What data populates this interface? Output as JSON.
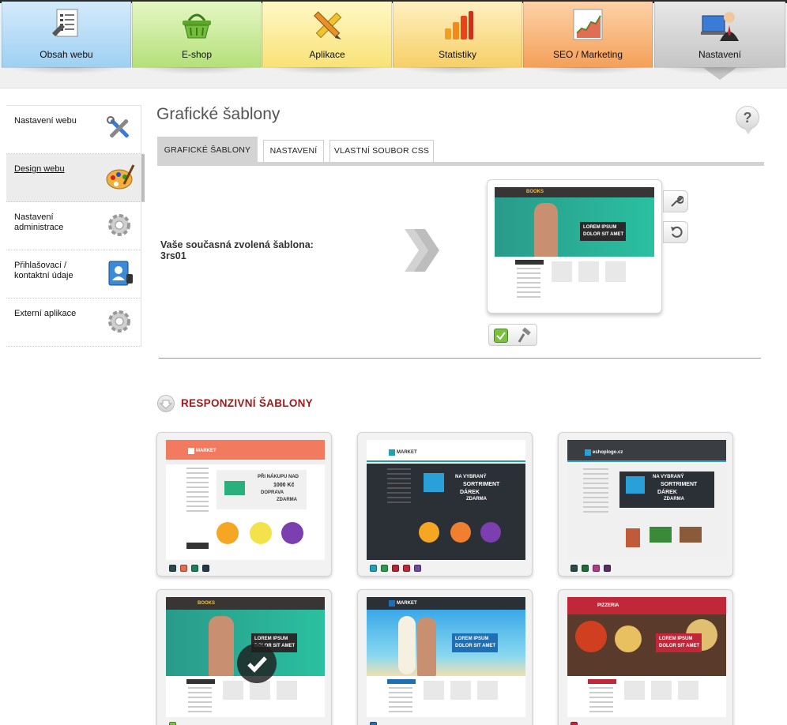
{
  "topnav": {
    "tabs": [
      {
        "label": "Obsah webu",
        "icon": "document-list-icon"
      },
      {
        "label": "E-shop",
        "icon": "shopping-basket-icon"
      },
      {
        "label": "Aplikace",
        "icon": "ruler-pencil-icon"
      },
      {
        "label": "Statistiky",
        "icon": "bar-chart-icon"
      },
      {
        "label": "SEO / Marketing",
        "icon": "growth-chart-icon"
      },
      {
        "label": "Nastavení",
        "icon": "user-computer-icon"
      }
    ],
    "active_index": 5
  },
  "sidebar": {
    "items": [
      {
        "label": "Nastavení webu",
        "icon": "tools-icon"
      },
      {
        "label": "Design webu",
        "icon": "palette-icon",
        "active": true
      },
      {
        "label": "Nastavení administrace",
        "icon": "gear-icon"
      },
      {
        "label": "Přihlašovací / kontaktní údaje",
        "icon": "contact-book-icon"
      },
      {
        "label": "Externí aplikace",
        "icon": "gear-icon"
      }
    ]
  },
  "main": {
    "title": "Grafické šablony",
    "help_label": "?",
    "tabs": [
      {
        "label": "GRAFICKÉ ŠABLONY",
        "active": true
      },
      {
        "label": "NASTAVENÍ"
      },
      {
        "label": "VLASTNÍ SOUBOR CSS"
      }
    ],
    "current": {
      "label": "Vaše současná zvolená šablona:",
      "value": "3rs01"
    },
    "section_title": "RESPONZIVNÍ ŠABLONY"
  },
  "preview_texts": {
    "books_logo": "BOOKS",
    "lorem1": "LOREM IPSUM",
    "lorem2": "DOLOR SIT AMET",
    "market_logo": "MARKET",
    "eshop_logo": "eshoplogo.cz",
    "shipping1": "PŘI NÁKUPU NAD",
    "shipping2": "1000 Kč",
    "shipping3": "DOPRAVA",
    "shipping4": "ZDARMA",
    "assort1": "NA VYBRANÝ",
    "assort2": "SORTRIMENT",
    "assort3": "DÁREK",
    "assort4": "ZDARMA",
    "pizza_logo": "PIZZERIA"
  },
  "templates": [
    {
      "name": "market-orange",
      "swatches": [
        "#2b4a4a",
        "#e76a4f",
        "#1e7f5c",
        "#1f3a4a"
      ]
    },
    {
      "name": "market-dark",
      "swatches": [
        "#1fa3b4",
        "#2e9b4a",
        "#b0282f",
        "#c0283a",
        "#6b4aa0"
      ]
    },
    {
      "name": "eshoplogo",
      "swatches": [
        "#2b4a4a",
        "#1e6b3a",
        "#b03a8a",
        "#5a2a6b"
      ]
    },
    {
      "name": "books",
      "swatches": [
        "#7bc043"
      ],
      "selected": true
    },
    {
      "name": "market-beach",
      "swatches": [
        "#1f6fb4"
      ]
    },
    {
      "name": "pizzeria",
      "swatches": [
        "#c0283a"
      ]
    }
  ],
  "colors": {
    "accent_red": "#9b1b1b",
    "tab_active_bg": "#d3d3d3"
  }
}
